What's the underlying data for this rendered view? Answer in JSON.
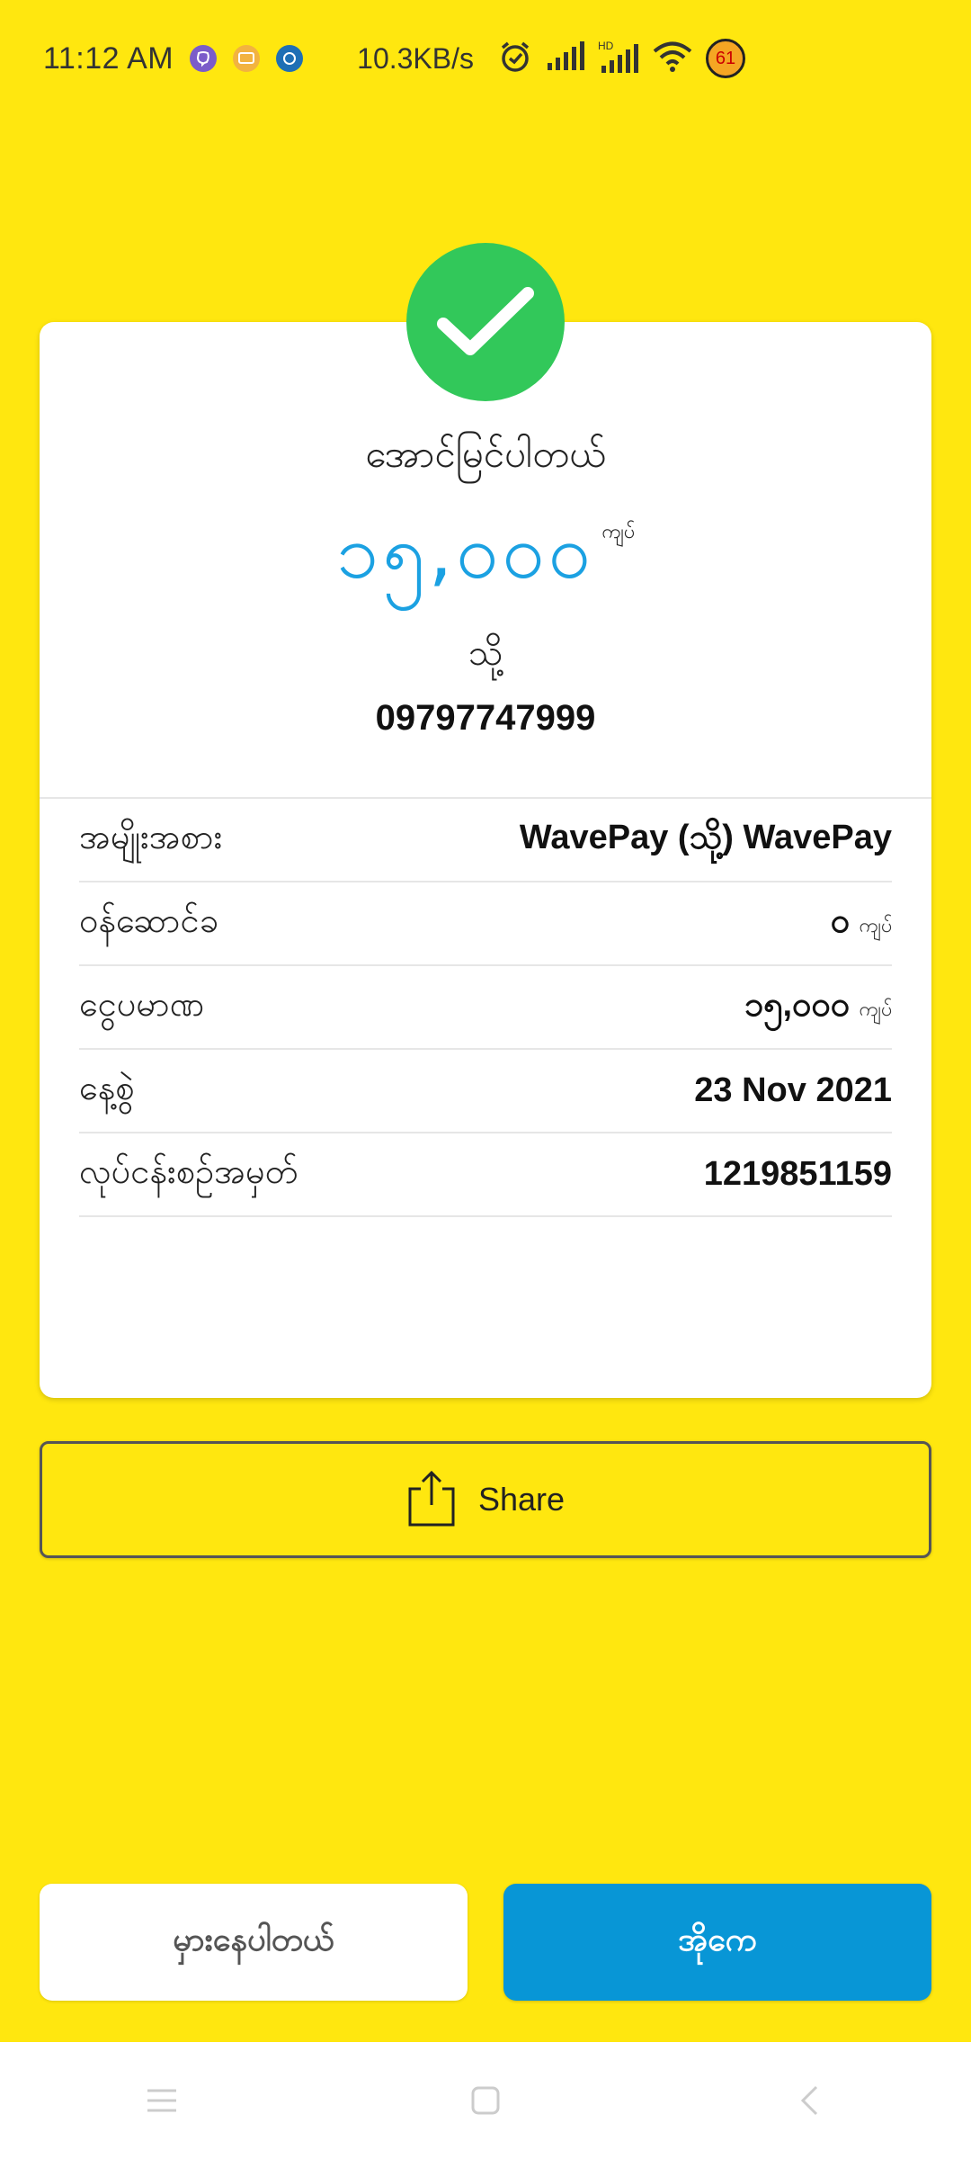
{
  "status_bar": {
    "time": "11:12 AM",
    "speed": "10.3KB/s",
    "battery": "61",
    "icons": [
      "viber-icon",
      "message-icon",
      "app-icon",
      "alarm-icon",
      "signal-icon",
      "hd-signal-icon",
      "wifi-icon"
    ]
  },
  "receipt": {
    "status_title": "အောင်မြင်ပါတယ်",
    "amount": "၁၅,၀၀၀",
    "amount_unit": "ကျပ်",
    "to_label": "သို့",
    "recipient": "09797747999",
    "details": [
      {
        "label": "အမျိုးအစား",
        "value": "WavePay (သို့) WavePay",
        "unit": ""
      },
      {
        "label": "ဝန်ဆောင်ခ",
        "value": "၀",
        "unit": "ကျပ်"
      },
      {
        "label": "ငွေပမာဏ",
        "value": "၁၅,၀၀၀",
        "unit": "ကျပ်"
      },
      {
        "label": "နေ့စွဲ",
        "value": "23 Nov 2021",
        "unit": ""
      },
      {
        "label": "လုပ်ငန်းစဉ်အမှတ်",
        "value": "1219851159",
        "unit": ""
      }
    ]
  },
  "share_button": {
    "label": "Share"
  },
  "actions": {
    "secondary": "မှားနေပါတယ်",
    "primary": "အိုကေ"
  },
  "colors": {
    "background": "#FFE70F",
    "accent_blue": "#1BA1E2",
    "primary_button": "#0896D6",
    "success_green": "#32C85A"
  }
}
